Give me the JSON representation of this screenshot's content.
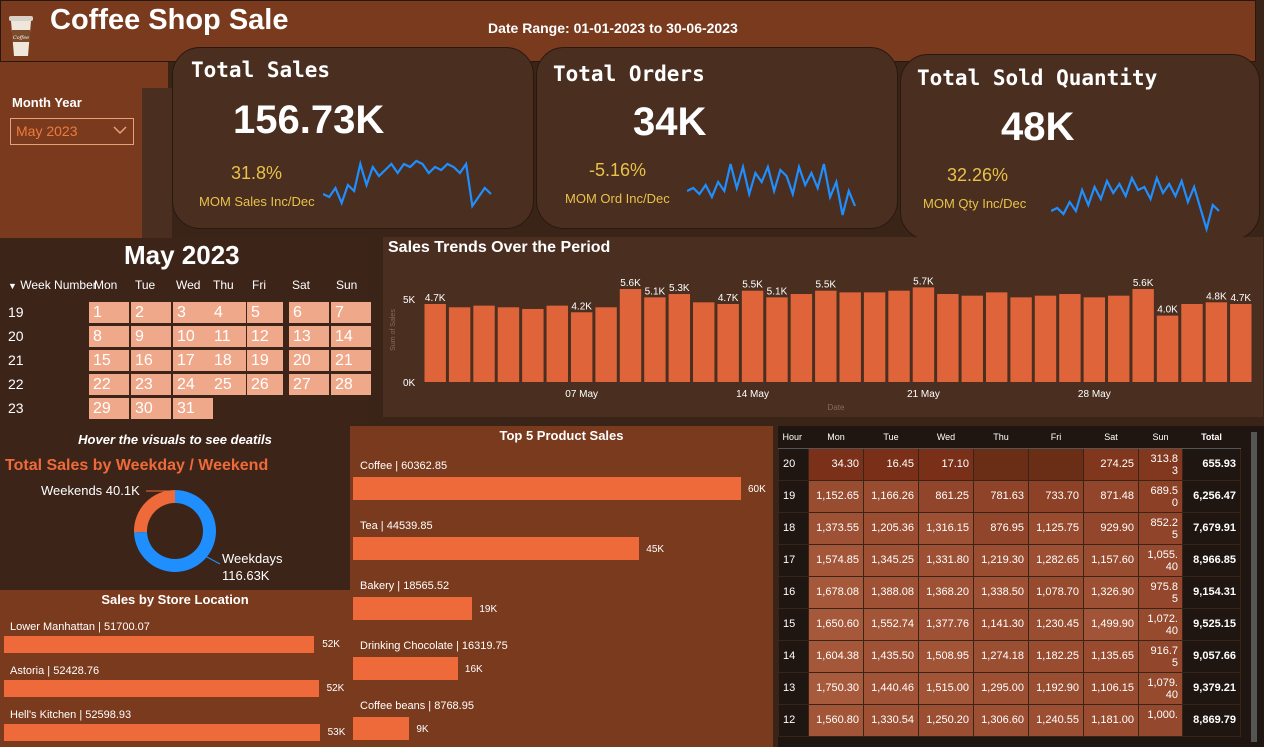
{
  "header": {
    "title": "Coffee Shop Sale",
    "date_range": "Date Range: 01-01-2023 to 30-06-2023",
    "logo_text": "Coffee"
  },
  "filter": {
    "label": "Month Year",
    "value": "May 2023"
  },
  "kpis": [
    {
      "title": "Total Sales",
      "value": "156.73K",
      "pct": "31.8%",
      "pct_label": "MOM Sales Inc/Dec",
      "spark": [
        4.6,
        4.5,
        4.8,
        4.3,
        4.9,
        4.7,
        5.6,
        4.9,
        5.5,
        5.2,
        5.4,
        5.6,
        5.3,
        5.6,
        5.5,
        5.7,
        5.6,
        5.3,
        5.5,
        5.4,
        5.6,
        5.5,
        5.3,
        5.6,
        4.2,
        4.5,
        4.8,
        4.6
      ]
    },
    {
      "title": "Total Orders",
      "value": "34K",
      "pct": "-5.16%",
      "pct_label": "MOM Ord Inc/Dec",
      "spark": [
        4.7,
        4.8,
        4.6,
        4.9,
        4.5,
        5.0,
        4.7,
        5.6,
        4.8,
        5.5,
        4.6,
        5.3,
        5.0,
        5.5,
        4.7,
        5.4,
        5.2,
        4.6,
        5.5,
        4.9,
        5.3,
        4.8,
        5.6,
        4.5,
        5.0,
        3.9,
        4.7,
        4.2
      ]
    },
    {
      "title": "Total Sold Quantity",
      "value": "48K",
      "pct": "32.26%",
      "pct_label": "MOM Qty Inc/Dec",
      "spark": [
        4.5,
        4.6,
        4.4,
        4.8,
        4.5,
        5.2,
        4.7,
        5.3,
        4.9,
        5.5,
        5.1,
        5.4,
        5.0,
        5.6,
        5.2,
        5.3,
        4.9,
        5.6,
        5.1,
        5.4,
        5.0,
        5.5,
        4.8,
        5.3,
        4.6,
        3.9,
        4.7,
        4.5
      ]
    }
  ],
  "calendar": {
    "title": "May 2023",
    "week_header": "Week Number",
    "days": [
      "Mon",
      "Tue",
      "Wed",
      "Thu",
      "Fri",
      "Sat",
      "Sun"
    ],
    "weeks": [
      {
        "n": "19",
        "d": [
          "1",
          "2",
          "3",
          "4",
          "5",
          "6",
          "7"
        ]
      },
      {
        "n": "20",
        "d": [
          "8",
          "9",
          "10",
          "11",
          "12",
          "13",
          "14"
        ]
      },
      {
        "n": "21",
        "d": [
          "15",
          "16",
          "17",
          "18",
          "19",
          "20",
          "21"
        ]
      },
      {
        "n": "22",
        "d": [
          "22",
          "23",
          "24",
          "25",
          "26",
          "27",
          "28"
        ]
      },
      {
        "n": "23",
        "d": [
          "29",
          "30",
          "31",
          "",
          "",
          "",
          ""
        ]
      }
    ]
  },
  "chart_data": [
    {
      "type": "bar",
      "title": "Sales Trends Over the Period",
      "xlabel": "Date",
      "ylabel": "Sum of Sales",
      "ylim": [
        0,
        6
      ],
      "x_ticks": [
        "07 May",
        "14 May",
        "21 May",
        "28 May"
      ],
      "y_ticks": [
        "0K",
        "5K"
      ],
      "values": [
        4.7,
        4.5,
        4.6,
        4.5,
        4.4,
        4.6,
        4.2,
        4.5,
        5.6,
        5.1,
        5.3,
        4.8,
        4.7,
        5.5,
        5.1,
        5.3,
        5.5,
        5.4,
        5.4,
        5.5,
        5.7,
        5.3,
        5.2,
        5.4,
        5.1,
        5.2,
        5.3,
        5.1,
        5.2,
        5.6,
        4.0,
        4.7,
        4.8,
        4.7
      ],
      "labels": [
        "4.7K",
        "",
        "",
        "",
        "",
        "",
        "4.2K",
        "",
        "5.6K",
        "5.1K",
        "5.3K",
        "",
        "4.7K",
        "5.5K",
        "5.1K",
        "",
        "5.5K",
        "",
        "",
        "",
        "5.7K",
        "",
        "",
        "",
        "",
        "",
        "",
        "",
        "",
        "5.6K",
        "4.0K",
        "",
        "4.8K",
        "4.7K"
      ]
    },
    {
      "type": "pie",
      "title": "Total Sales by Weekday / Weekend",
      "labels": [
        "Weekends 40.1K",
        "Weekdays",
        "116.63K"
      ],
      "values": [
        40.1,
        116.63
      ],
      "names": [
        "Weekends",
        "Weekdays"
      ]
    },
    {
      "type": "bar",
      "title": "Top 5 Product Sales",
      "categories": [
        "Coffee | 60362.85",
        "Tea | 44539.85",
        "Bakery | 18565.52",
        "Drinking Chocolate | 16319.75",
        "Coffee beans | 8768.95"
      ],
      "values": [
        60362.85,
        44539.85,
        18565.52,
        16319.75,
        8768.95
      ],
      "data_labels": [
        "60K",
        "45K",
        "19K",
        "16K",
        "9K"
      ]
    },
    {
      "type": "bar",
      "title": "Sales by Store Location",
      "categories": [
        "Lower Manhattan | 51700.07",
        "Astoria | 52428.76",
        "Hell's Kitchen | 52598.93"
      ],
      "values": [
        51700.07,
        52428.76,
        52598.93
      ],
      "data_labels": [
        "52K",
        "52K",
        "53K"
      ]
    }
  ],
  "hover_note": "Hover the visuals to see deatils",
  "heatmap": {
    "headers": [
      "Hour",
      "Mon",
      "Tue",
      "Wed",
      "Thu",
      "Fri",
      "Sat",
      "Sun",
      "Total"
    ],
    "rows": [
      [
        "20",
        "34.30",
        "16.45",
        "17.10",
        "",
        "",
        "274.25",
        "313.8\n3",
        "655.93"
      ],
      [
        "19",
        "1,152.65",
        "1,166.26",
        "861.25",
        "781.63",
        "733.70",
        "871.48",
        "689.5\n0",
        "6,256.47"
      ],
      [
        "18",
        "1,373.55",
        "1,205.36",
        "1,316.15",
        "876.95",
        "1,125.75",
        "929.90",
        "852.2\n5",
        "7,679.91"
      ],
      [
        "17",
        "1,574.85",
        "1,345.25",
        "1,331.80",
        "1,219.30",
        "1,282.65",
        "1,157.60",
        "1,055.\n40",
        "8,966.85"
      ],
      [
        "16",
        "1,678.08",
        "1,388.08",
        "1,368.20",
        "1,338.50",
        "1,078.70",
        "1,326.90",
        "975.8\n5",
        "9,154.31"
      ],
      [
        "15",
        "1,650.60",
        "1,552.74",
        "1,377.76",
        "1,141.30",
        "1,230.45",
        "1,499.90",
        "1,072.\n40",
        "9,525.15"
      ],
      [
        "14",
        "1,604.38",
        "1,435.50",
        "1,508.95",
        "1,274.18",
        "1,182.25",
        "1,135.65",
        "916.7\n5",
        "9,057.66"
      ],
      [
        "13",
        "1,750.30",
        "1,440.46",
        "1,515.00",
        "1,295.00",
        "1,192.90",
        "1,106.15",
        "1,079.\n40",
        "9,379.21"
      ],
      [
        "12",
        "1,560.80",
        "1,330.54",
        "1,250.20",
        "1,306.60",
        "1,240.55",
        "1,181.00",
        "1,000.",
        "8,869.79"
      ]
    ]
  }
}
